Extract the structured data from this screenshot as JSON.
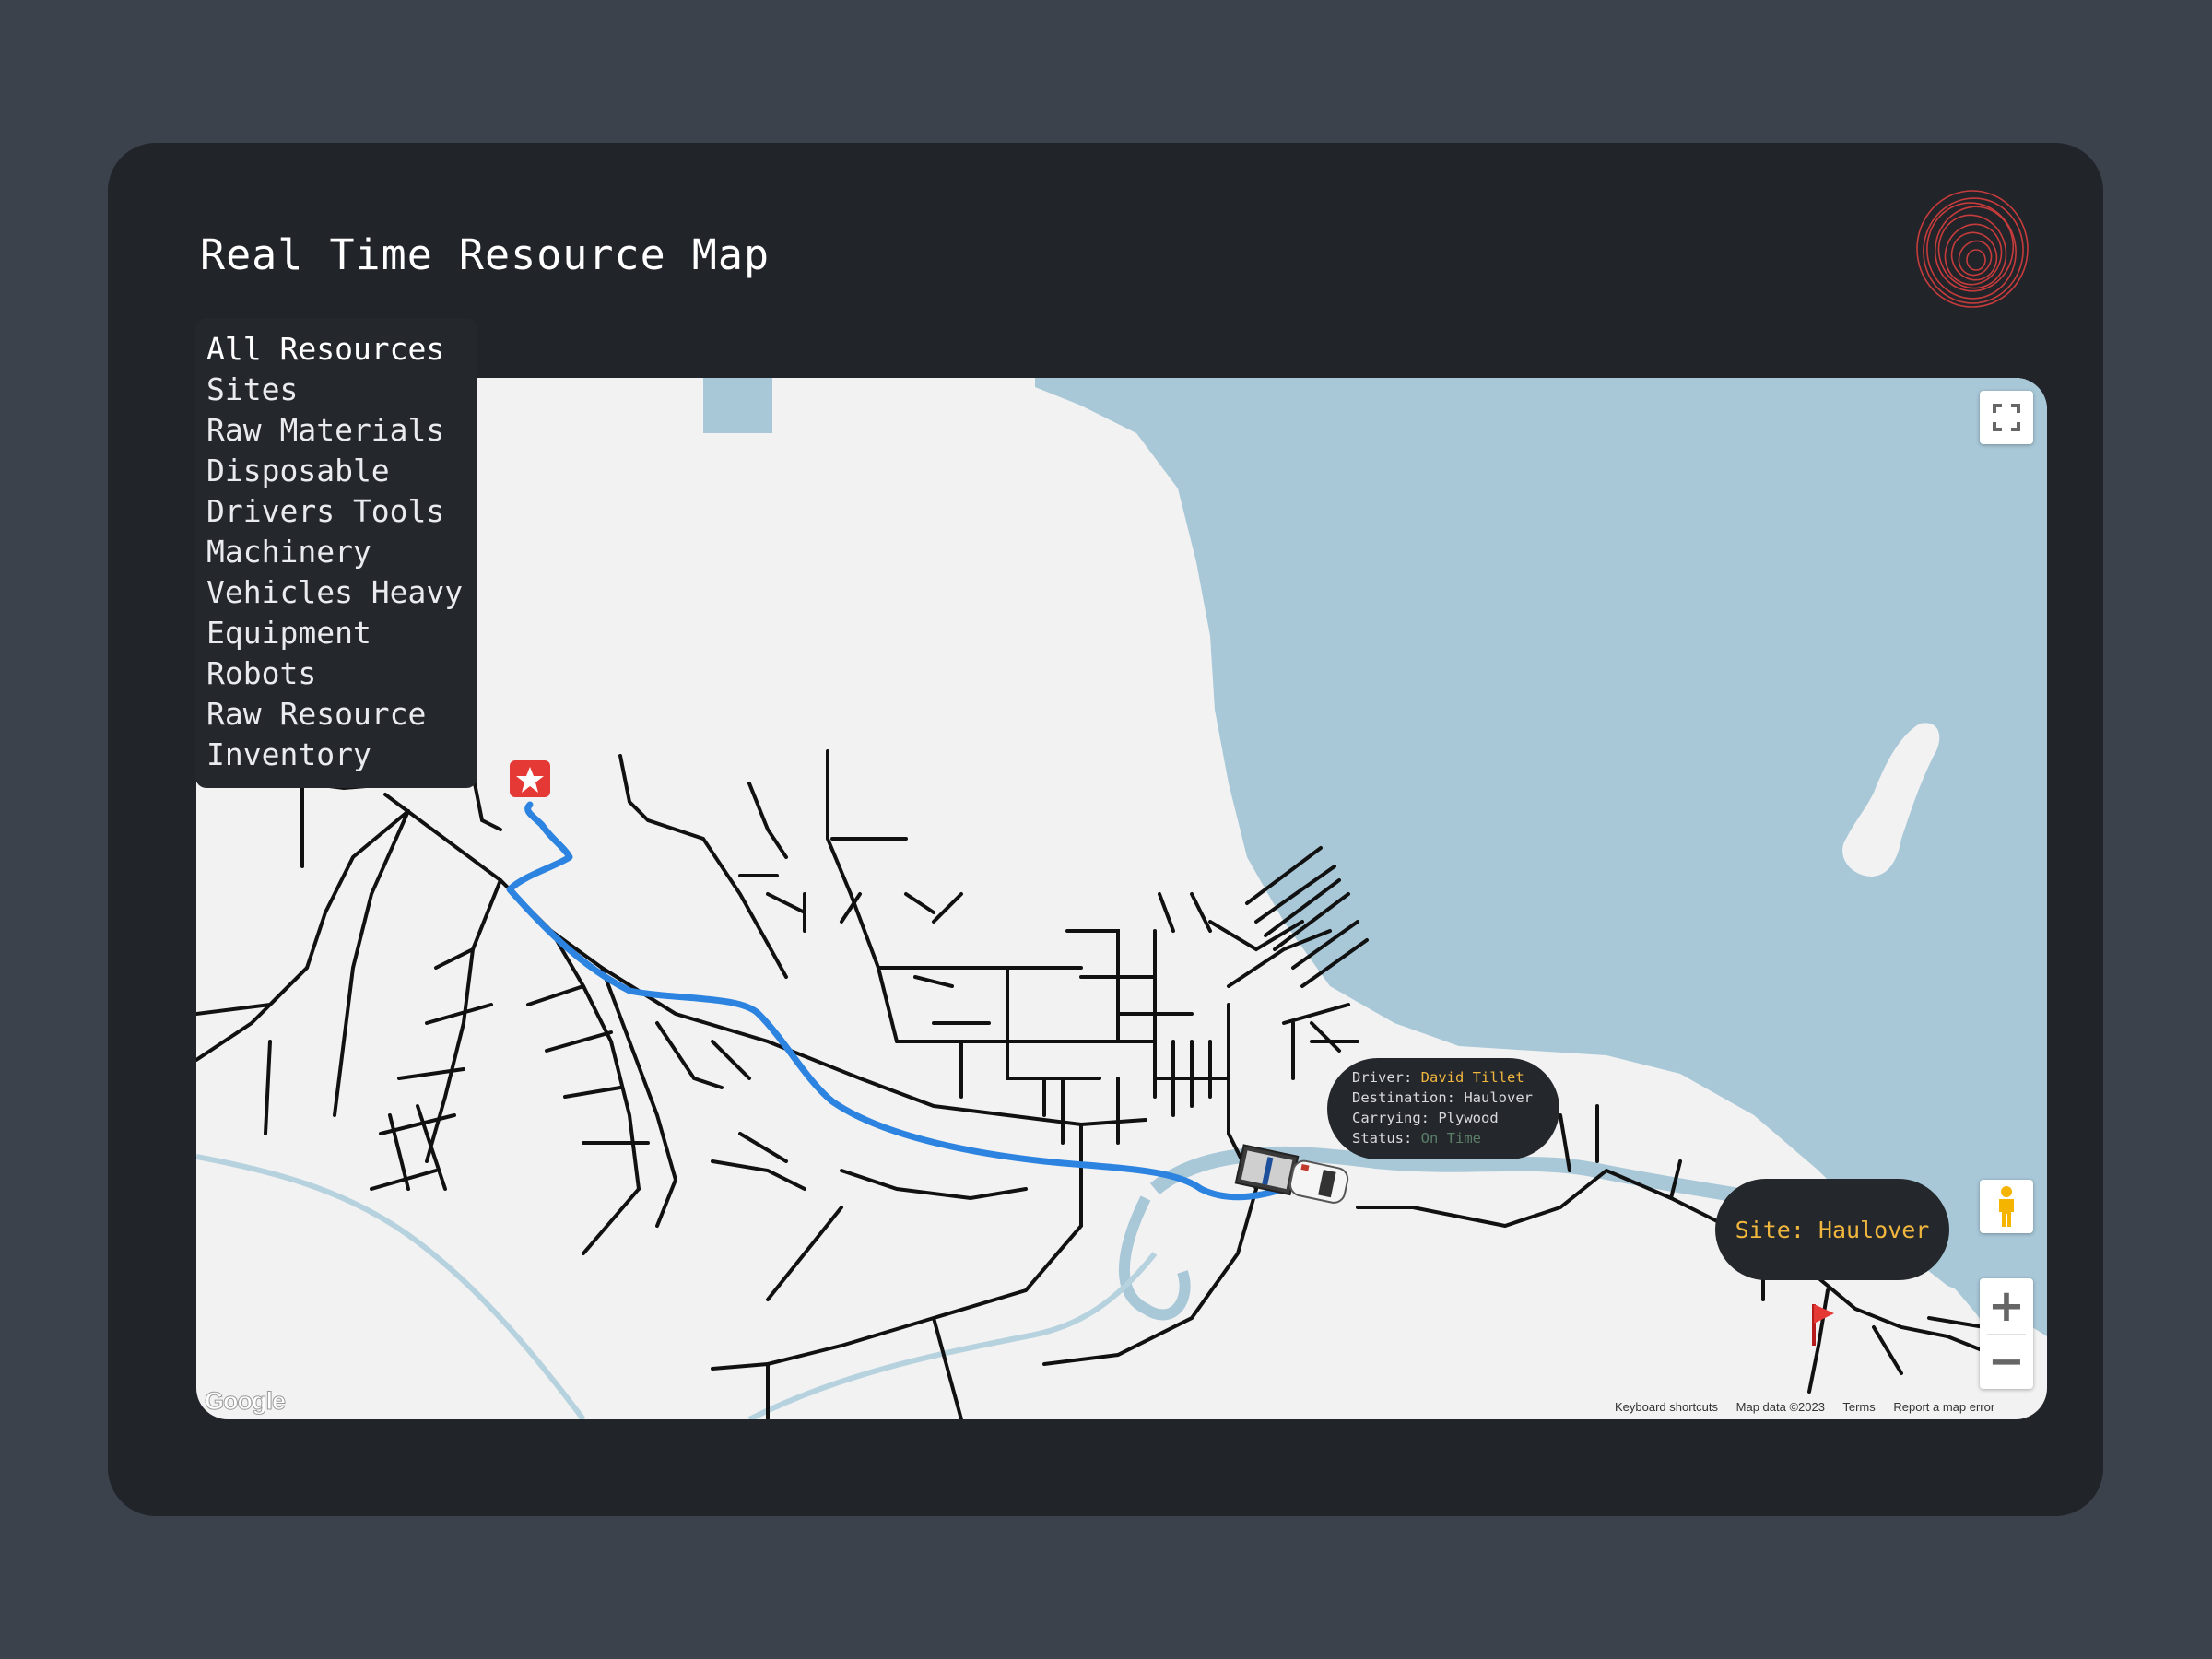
{
  "page": {
    "title": "Real Time Resource Map"
  },
  "sidebar": {
    "items": [
      {
        "label": "All Resources"
      },
      {
        "label": "Sites"
      },
      {
        "label": "Raw Materials"
      },
      {
        "label": "Disposable"
      },
      {
        "label": "Drivers Tools"
      },
      {
        "label": "Machinery"
      },
      {
        "label": "Vehicles Heavy"
      },
      {
        "label": "Equipment"
      },
      {
        "label": "Robots"
      },
      {
        "label": "Raw Resource"
      },
      {
        "label": "Inventory"
      }
    ]
  },
  "map": {
    "tooltip": {
      "driver_label": "Driver:",
      "driver_value": "David Tillet",
      "destination_label": "Destination:",
      "destination_value": "Haulover",
      "carrying_label": "Carrying:",
      "carrying_value": "Plywood",
      "status_label": "Status:",
      "status_value": "On Time"
    },
    "site_label": "Site: Haulover",
    "controls": {
      "zoom_in": "+",
      "zoom_out": "−"
    },
    "footer": {
      "shortcuts": "Keyboard shortcuts",
      "map_data": "Map data ©2023",
      "terms": "Terms",
      "report": "Report a map error"
    },
    "google_logo": "Google",
    "icons": {
      "fullscreen": "fullscreen-icon",
      "pegman": "street-view-pegman-icon",
      "origin": "star-marker-icon",
      "destination": "flag-marker-icon",
      "vehicle": "truck-icon"
    }
  },
  "colors": {
    "page_background": "#3b424c",
    "card_background": "#212429",
    "panel_background": "#24272c",
    "water": "#a8c8d8",
    "land": "#f2f2f2",
    "route": "#2d84e0",
    "highlight": "#f0b63e",
    "status_on_time": "#5a7f68",
    "marker_red": "#e53935",
    "logo_red": "#c63c3c"
  }
}
